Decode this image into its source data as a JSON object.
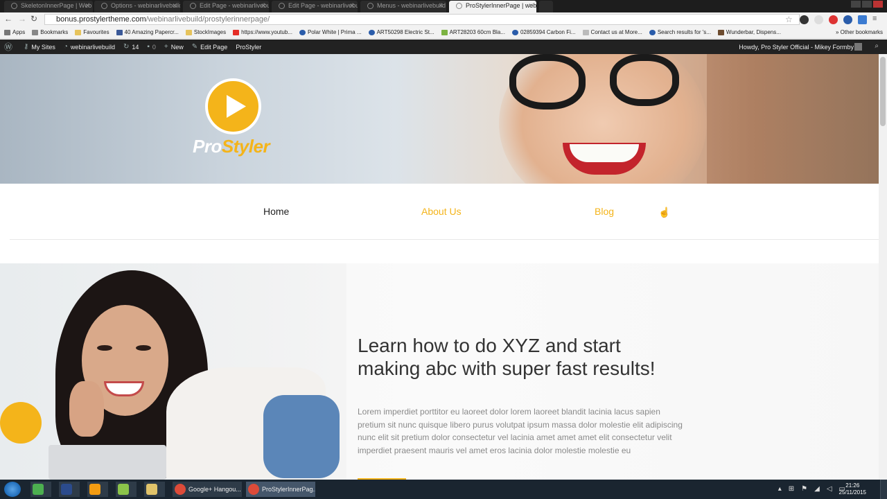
{
  "browser": {
    "tabs": [
      {
        "label": "SkeletonInnerPage | Web",
        "active": false
      },
      {
        "label": "Options - webinarlivebuild",
        "active": false
      },
      {
        "label": "Edit Page - webinarlivebu",
        "active": false
      },
      {
        "label": "Edit Page - webinarlivebu",
        "active": false
      },
      {
        "label": "Menus - webinarlivebuild",
        "active": false
      },
      {
        "label": "ProStylerInnerPage | web",
        "active": true
      }
    ],
    "url_host": "bonus.prostylertheme.com",
    "url_path": "/webinarlivebuild/prostylerinnerpage/",
    "bookmarks": [
      "Apps",
      "Bookmarks",
      "Favourites",
      "40 Amazing Papercr...",
      "StockImages",
      "https://www.youtub...",
      "Polar White | Prima ...",
      "ART50298 Electric St...",
      "ART28203 60cm Bla...",
      "02859394 Carbon Fi...",
      "Contact us at More...",
      "Search results for 's...",
      "Wunderbar, Dispens..."
    ],
    "other_bookmarks": "Other bookmarks"
  },
  "adminbar": {
    "my_sites": "My Sites",
    "site_name": "webinarlivebuild",
    "updates_count": "14",
    "comments_count": "0",
    "new_label": "New",
    "edit_page": "Edit Page",
    "theme": "ProStyler",
    "howdy": "Howdy, Pro Styler Official - Mikey Formby"
  },
  "logo": {
    "text_main": "Pro",
    "text_accent": "Styler"
  },
  "nav": {
    "home": "Home",
    "about": "About Us",
    "blog": "Blog"
  },
  "content": {
    "headline_line1": "Learn how to do XYZ and start",
    "headline_line2": "making abc with super fast results!",
    "body": "Lorem imperdiet porttitor eu laoreet dolor lorem laoreet blandit lacinia lacus sapien pretium sit nunc quisque libero purus volutpat ipsum massa dolor molestie elit adipiscing nunc elit sit pretium dolor consectetur vel lacinia amet amet amet elit consectetur velit imperdiet praesent mauris vel amet eros lacinia dolor molestie molestie eu"
  },
  "taskbar": {
    "apps": [
      {
        "label": "",
        "icon": "#4caf50"
      },
      {
        "label": "",
        "icon": "#2b4b8c"
      },
      {
        "label": "",
        "icon": "#f39c12"
      },
      {
        "label": "",
        "icon": "#8bc34a"
      },
      {
        "label": "",
        "icon": "#e0c36a"
      },
      {
        "label": "Google+ Hangou...",
        "icon": "#dd4b39"
      },
      {
        "label": "ProStylerInnerPag...",
        "icon": "#dd4b39"
      }
    ],
    "time": "21:26",
    "date": "25/11/2015"
  },
  "colors": {
    "brand_accent": "#f4b41a",
    "adminbar_bg": "#222222",
    "taskbar_bg": "#1a2530"
  }
}
